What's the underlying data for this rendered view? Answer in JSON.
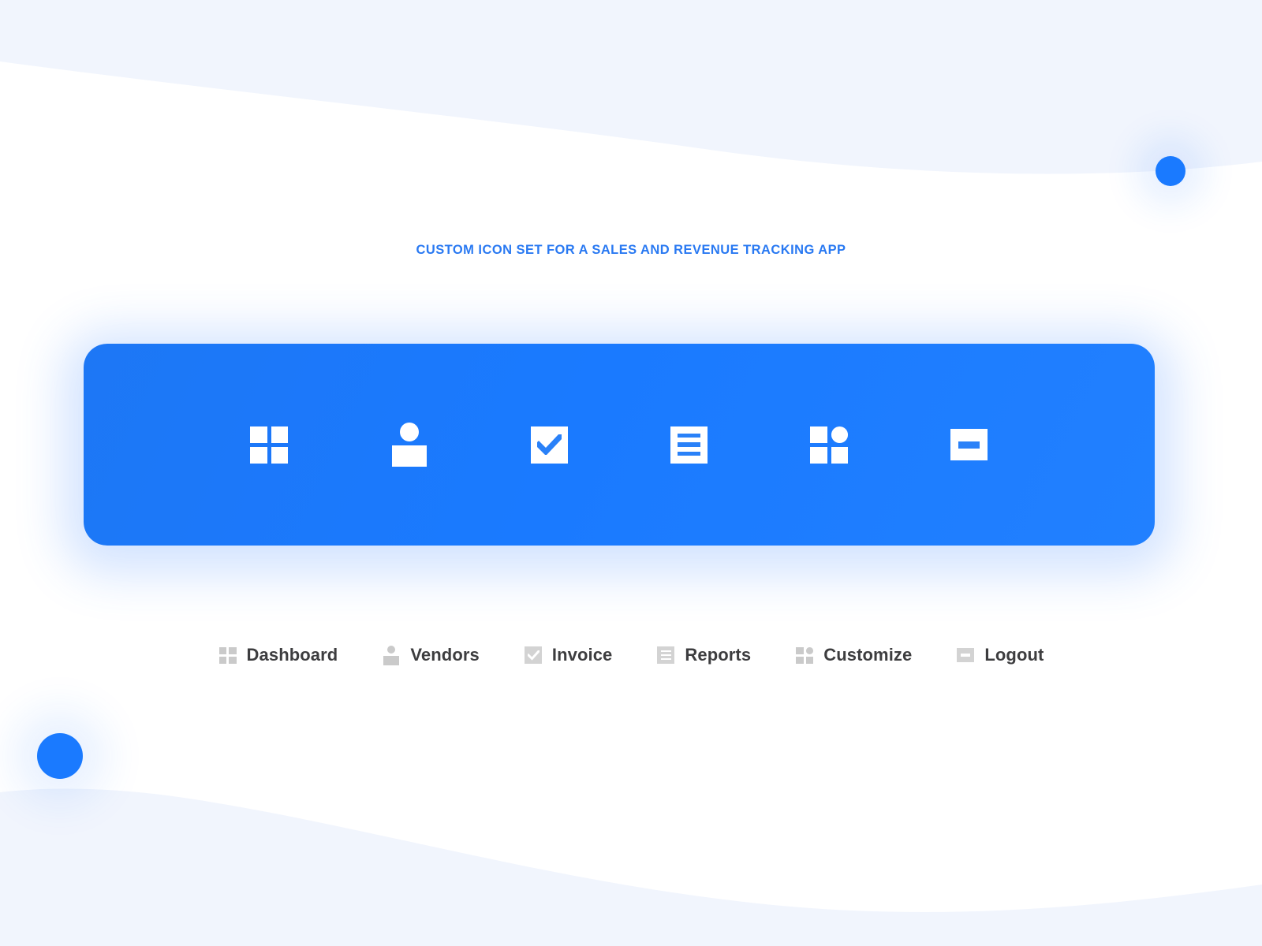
{
  "page": {
    "title": "CUSTOM ICON SET FOR A SALES AND REVENUE TRACKING APP"
  },
  "colors": {
    "accent_blue": "#1a7aff",
    "card_blue": "#1d77f5",
    "title_blue": "#2979f2",
    "wave_bg": "#f1f5fd",
    "page_bg": "#ffffff",
    "legend_icon_gray": "#cacaca",
    "legend_text_gray": "#3d3d3f"
  },
  "icon_card": {
    "icons": [
      {
        "name": "dashboard-icon",
        "glyph": "grid-4"
      },
      {
        "name": "vendors-icon",
        "glyph": "person"
      },
      {
        "name": "invoice-icon",
        "glyph": "checkbox"
      },
      {
        "name": "reports-icon",
        "glyph": "document-lines"
      },
      {
        "name": "customize-icon",
        "glyph": "grid-3-plus-dot"
      },
      {
        "name": "logout-icon",
        "glyph": "minus-box"
      }
    ]
  },
  "legend": {
    "items": [
      {
        "label": "Dashboard",
        "icon": "dashboard-icon",
        "glyph": "grid-4"
      },
      {
        "label": "Vendors",
        "icon": "vendors-icon",
        "glyph": "person"
      },
      {
        "label": "Invoice",
        "icon": "invoice-icon",
        "glyph": "checkbox"
      },
      {
        "label": "Reports",
        "icon": "reports-icon",
        "glyph": "document-lines"
      },
      {
        "label": "Customize",
        "icon": "customize-icon",
        "glyph": "grid-3-plus-dot"
      },
      {
        "label": "Logout",
        "icon": "logout-icon",
        "glyph": "minus-box"
      }
    ]
  },
  "decor": {
    "circle_top_right": "blue-dot",
    "circle_bottom_left": "blue-dot"
  }
}
